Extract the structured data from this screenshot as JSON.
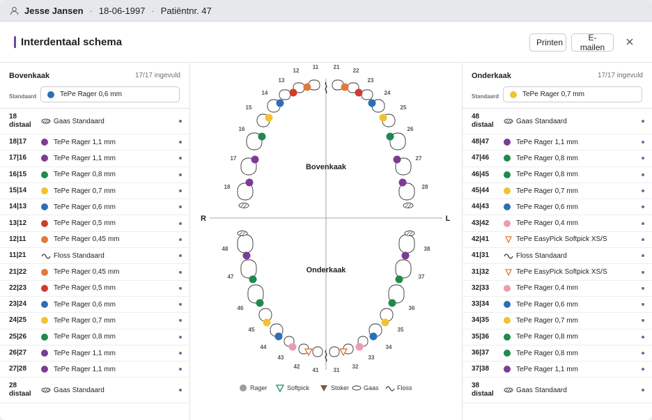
{
  "patient": {
    "name": "Jesse Jansen",
    "dob": "18-06-1997",
    "number": "Patiëntnr. 47",
    "sep": "·"
  },
  "header": {
    "title": "Interdentaal schema",
    "print_label": "Printen",
    "email_label": "E-mailen",
    "close_icon": "close-icon"
  },
  "colors": {
    "accent": "#6a4aa0",
    "purple": "#7a3c96",
    "green": "#1f8a4d",
    "yellow": "#f1c232",
    "blue": "#2c6fb5",
    "red": "#d23a2f",
    "orange": "#e07a3a",
    "pink": "#ec9bb0"
  },
  "upper": {
    "title": "Bovenkaak",
    "count": "17/17 ingevuld",
    "standard_label": "Standaard",
    "standard_value": "TePe  Rager 0,6 mm",
    "standard_color": "#2c6fb5",
    "rows": [
      {
        "label": "18 distaal",
        "icon": "gauze",
        "color": "",
        "text": "Gaas Standaard"
      },
      {
        "label": "18|17",
        "icon": "dot",
        "color": "#7a3c96",
        "text": "TePe  Rager 1,1 mm"
      },
      {
        "label": "17|16",
        "icon": "dot",
        "color": "#7a3c96",
        "text": "TePe  Rager 1,1 mm"
      },
      {
        "label": "16|15",
        "icon": "dot",
        "color": "#1f8a4d",
        "text": "TePe  Rager 0,8 mm"
      },
      {
        "label": "15|14",
        "icon": "dot",
        "color": "#f1c232",
        "text": "TePe  Rager 0,7 mm"
      },
      {
        "label": "14|13",
        "icon": "dot",
        "color": "#2c6fb5",
        "text": "TePe  Rager 0,6 mm"
      },
      {
        "label": "13|12",
        "icon": "dot",
        "color": "#d23a2f",
        "text": "TePe  Rager 0,5 mm"
      },
      {
        "label": "12|11",
        "icon": "dot",
        "color": "#e07a3a",
        "text": "TePe  Rager 0,45 mm"
      },
      {
        "label": "11|21",
        "icon": "floss",
        "color": "",
        "text": "Floss Standaard"
      },
      {
        "label": "21|22",
        "icon": "dot",
        "color": "#e07a3a",
        "text": "TePe  Rager 0,45 mm"
      },
      {
        "label": "22|23",
        "icon": "dot",
        "color": "#d23a2f",
        "text": "TePe  Rager 0,5 mm"
      },
      {
        "label": "23|24",
        "icon": "dot",
        "color": "#2c6fb5",
        "text": "TePe  Rager 0,6 mm"
      },
      {
        "label": "24|25",
        "icon": "dot",
        "color": "#f1c232",
        "text": "TePe  Rager 0,7 mm"
      },
      {
        "label": "25|26",
        "icon": "dot",
        "color": "#1f8a4d",
        "text": "TePe  Rager 0,8 mm"
      },
      {
        "label": "26|27",
        "icon": "dot",
        "color": "#7a3c96",
        "text": "TePe  Rager 1,1 mm"
      },
      {
        "label": "27|28",
        "icon": "dot",
        "color": "#7a3c96",
        "text": "TePe  Rager 1,1 mm"
      },
      {
        "label": "28 distaal",
        "icon": "gauze",
        "color": "",
        "text": "Gaas Standaard"
      }
    ]
  },
  "lower": {
    "title": "Onderkaak",
    "count": "17/17 ingevuld",
    "standard_label": "Standaard",
    "standard_value": "TePe  Rager 0,7 mm",
    "standard_color": "#f1c232",
    "rows": [
      {
        "label": "48 distaal",
        "icon": "gauze",
        "color": "",
        "text": "Gaas Standaard"
      },
      {
        "label": "48|47",
        "icon": "dot",
        "color": "#7a3c96",
        "text": "TePe  Rager 1,1 mm"
      },
      {
        "label": "47|46",
        "icon": "dot",
        "color": "#1f8a4d",
        "text": "TePe  Rager 0,8 mm"
      },
      {
        "label": "46|45",
        "icon": "dot",
        "color": "#1f8a4d",
        "text": "TePe  Rager 0,8 mm"
      },
      {
        "label": "45|44",
        "icon": "dot",
        "color": "#f1c232",
        "text": "TePe  Rager 0,7 mm"
      },
      {
        "label": "44|43",
        "icon": "dot",
        "color": "#2c6fb5",
        "text": "TePe  Rager 0,6 mm"
      },
      {
        "label": "43|42",
        "icon": "dot",
        "color": "#ec9bb0",
        "text": "TePe  Rager 0,4 mm"
      },
      {
        "label": "42|41",
        "icon": "softpick",
        "color": "#e07a3a",
        "text": "TePe EasyPick  Softpick XS/S"
      },
      {
        "label": "41|31",
        "icon": "floss",
        "color": "",
        "text": "Floss Standaard"
      },
      {
        "label": "31|32",
        "icon": "softpick",
        "color": "#e07a3a",
        "text": "TePe EasyPick  Softpick XS/S"
      },
      {
        "label": "32|33",
        "icon": "dot",
        "color": "#ec9bb0",
        "text": "TePe  Rager 0,4 mm"
      },
      {
        "label": "33|34",
        "icon": "dot",
        "color": "#2c6fb5",
        "text": "TePe  Rager 0,6 mm"
      },
      {
        "label": "34|35",
        "icon": "dot",
        "color": "#f1c232",
        "text": "TePe  Rager 0,7 mm"
      },
      {
        "label": "35|36",
        "icon": "dot",
        "color": "#1f8a4d",
        "text": "TePe  Rager 0,8 mm"
      },
      {
        "label": "36|37",
        "icon": "dot",
        "color": "#1f8a4d",
        "text": "TePe  Rager 0,8 mm"
      },
      {
        "label": "37|38",
        "icon": "dot",
        "color": "#7a3c96",
        "text": "TePe  Rager 1,1 mm"
      },
      {
        "label": "38 distaal",
        "icon": "gauze",
        "color": "",
        "text": "Gaas Standaard"
      }
    ]
  },
  "diagram": {
    "upper_label": "Bovenkaak",
    "lower_label": "Onderkaak",
    "right_label": "R",
    "left_label": "L",
    "upper_teeth": [
      "18",
      "17",
      "16",
      "15",
      "14",
      "13",
      "12",
      "11",
      "21",
      "22",
      "23",
      "24",
      "25",
      "26",
      "27",
      "28"
    ],
    "lower_teeth": [
      "48",
      "47",
      "46",
      "45",
      "44",
      "43",
      "42",
      "41",
      "31",
      "32",
      "33",
      "34",
      "35",
      "36",
      "37",
      "38"
    ],
    "upper_markers": [
      "#7a3c96",
      "#7a3c96",
      "#1f8a4d",
      "#f1c232",
      "#2c6fb5",
      "#d23a2f",
      "#e07a3a",
      "#e07a3a",
      "#d23a2f",
      "#2c6fb5",
      "#f1c232",
      "#1f8a4d",
      "#7a3c96",
      "#7a3c96"
    ],
    "lower_markers": [
      "#7a3c96",
      "#1f8a4d",
      "#1f8a4d",
      "#f1c232",
      "#2c6fb5",
      "#ec9bb0",
      "softpick",
      "softpick",
      "#ec9bb0",
      "#2c6fb5",
      "#f1c232",
      "#1f8a4d",
      "#1f8a4d",
      "#7a3c96"
    ],
    "legend": [
      {
        "icon": "rager",
        "label": "Rager"
      },
      {
        "icon": "softpick",
        "label": "Softpick"
      },
      {
        "icon": "stoker",
        "label": "Stoker"
      },
      {
        "icon": "gauze",
        "label": "Gaas"
      },
      {
        "icon": "floss",
        "label": "Floss"
      }
    ]
  }
}
